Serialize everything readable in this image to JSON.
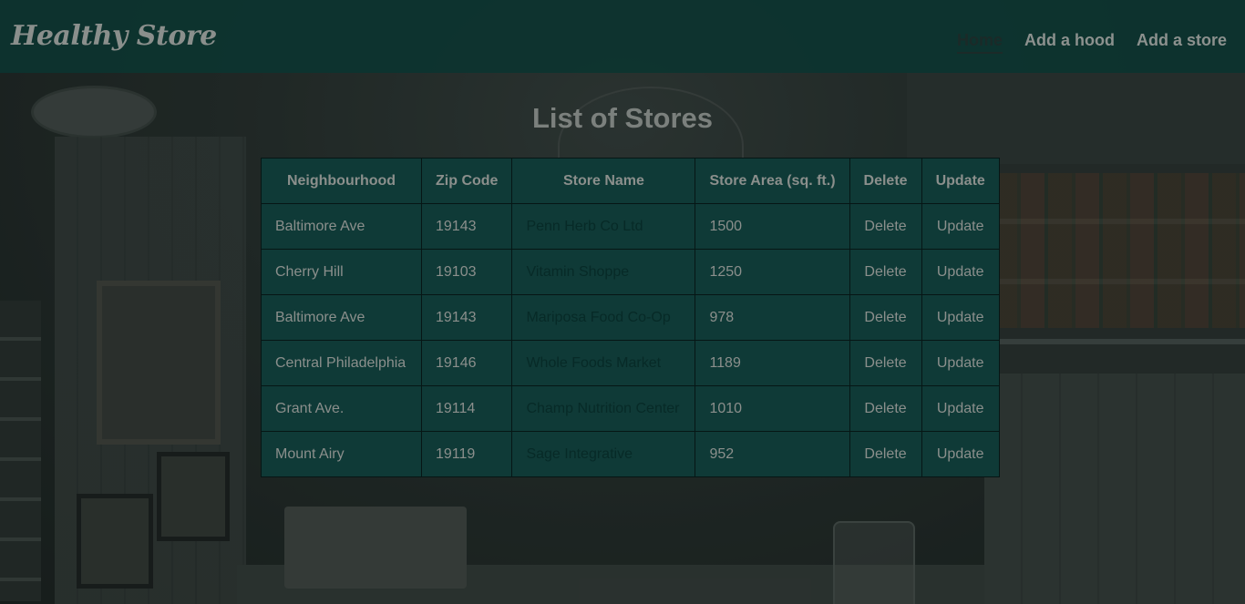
{
  "header": {
    "brand": "Healthy Store",
    "nav": [
      {
        "label": "Home",
        "active": true
      },
      {
        "label": "Add a hood",
        "active": false
      },
      {
        "label": "Add a store",
        "active": false
      }
    ]
  },
  "main": {
    "title": "List of Stores",
    "table": {
      "columns": [
        "Neighbourhood",
        "Zip Code",
        "Store Name",
        "Store Area (sq. ft.)",
        "Delete",
        "Update"
      ],
      "rows": [
        {
          "neighbourhood": "Baltimore Ave",
          "zip": "19143",
          "store_name": "Penn Herb Co Ltd",
          "area": "1500",
          "delete": "Delete",
          "update": "Update"
        },
        {
          "neighbourhood": "Cherry Hill",
          "zip": "19103",
          "store_name": "Vitamin Shoppe",
          "area": "1250",
          "delete": "Delete",
          "update": "Update"
        },
        {
          "neighbourhood": "Baltimore Ave",
          "zip": "19143",
          "store_name": "Mariposa Food Co-Op",
          "area": "978",
          "delete": "Delete",
          "update": "Update"
        },
        {
          "neighbourhood": "Central Philadelphia",
          "zip": "19146",
          "store_name": "Whole Foods Market",
          "area": "1189",
          "delete": "Delete",
          "update": "Update"
        },
        {
          "neighbourhood": "Grant Ave.",
          "zip": "19114",
          "store_name": "Champ Nutrition Center",
          "area": "1010",
          "delete": "Delete",
          "update": "Update"
        },
        {
          "neighbourhood": "Mount Airy",
          "zip": "19119",
          "store_name": "Sage Integrative",
          "area": "952",
          "delete": "Delete",
          "update": "Update"
        }
      ]
    }
  },
  "colors": {
    "navbar": "#0c3430",
    "table_bg": "#0f3a37",
    "text_muted": "#8b8f8c",
    "store_name_text": "#072a27"
  }
}
